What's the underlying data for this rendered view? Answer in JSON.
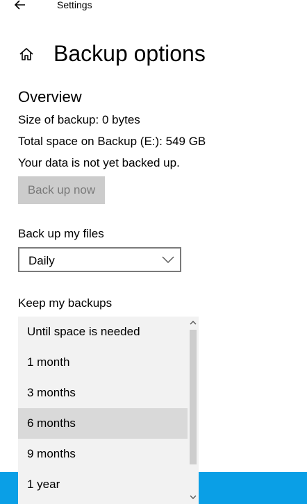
{
  "window": {
    "title": "Settings"
  },
  "page": {
    "title": "Backup options"
  },
  "overview": {
    "title": "Overview",
    "size_of_backup": "Size of backup: 0 bytes",
    "total_space": "Total space on Backup (E:): 549 GB",
    "status": "Your data is not yet backed up.",
    "backup_button": "Back up now"
  },
  "backup_frequency": {
    "label": "Back up my files",
    "selected": "Daily"
  },
  "keep_backups": {
    "label": "Keep my backups",
    "options": [
      "Until space is needed",
      "1 month",
      "3 months",
      "6 months",
      "9 months",
      "1 year"
    ],
    "highlighted": "6 months"
  },
  "icons": {
    "back": "back-arrow-icon",
    "home": "home-icon",
    "chevron": "chevron-down-icon",
    "scroll_up": "scroll-up-icon",
    "scroll_down": "scroll-down-icon"
  },
  "colors": {
    "disabled_button_bg": "#cccccc",
    "disabled_button_text": "#7a7a7a",
    "dropdown_bg": "#f2f2f2",
    "dropdown_highlight": "#d9d9d9",
    "taskbar": "#0a9fe6"
  }
}
